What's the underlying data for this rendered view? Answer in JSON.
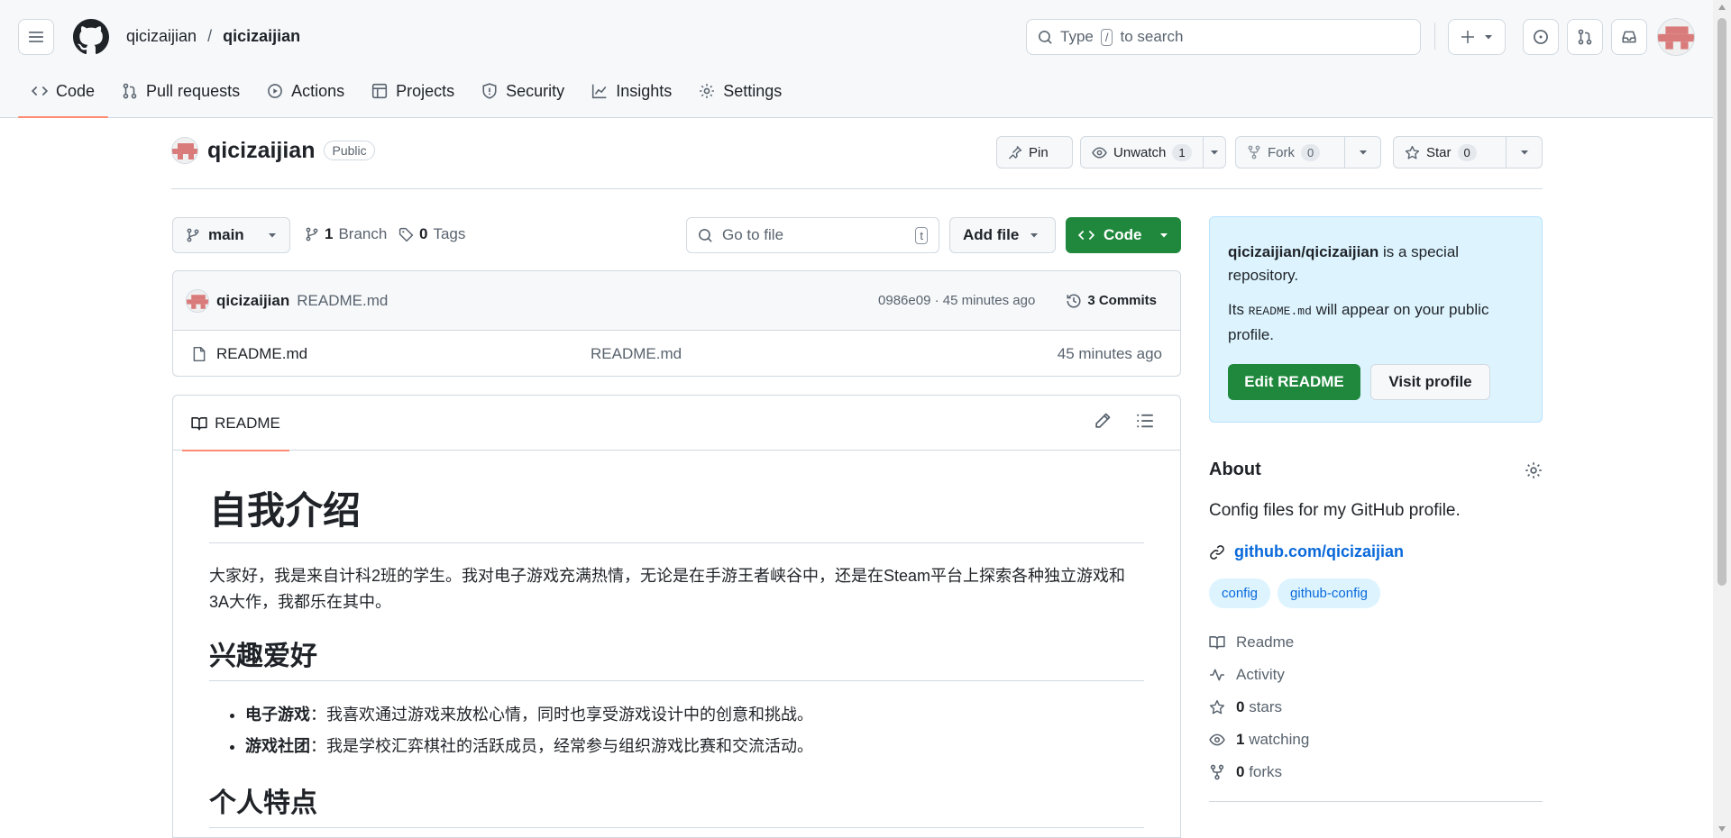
{
  "header": {
    "owner": "qicizaijian",
    "repo": "qicizaijian",
    "search_prefix": "Type",
    "search_key": "/",
    "search_suffix": "to search"
  },
  "nav_tabs": [
    {
      "label": "Code"
    },
    {
      "label": "Pull requests"
    },
    {
      "label": "Actions"
    },
    {
      "label": "Projects"
    },
    {
      "label": "Security"
    },
    {
      "label": "Insights"
    },
    {
      "label": "Settings"
    }
  ],
  "repo": {
    "name": "qicizaijian",
    "visibility": "Public",
    "pin_label": "Pin",
    "unwatch_label": "Unwatch",
    "watch_count": "1",
    "fork_label": "Fork",
    "fork_count": "0",
    "star_label": "Star",
    "star_count": "0"
  },
  "toolbar": {
    "branch": "main",
    "branch_count": "1",
    "branch_label": "Branch",
    "tag_count": "0",
    "tag_label": "Tags",
    "goto_placeholder": "Go to file",
    "goto_key": "t",
    "add_file": "Add file",
    "code": "Code"
  },
  "commit": {
    "author": "qicizaijian",
    "message": "README.md",
    "sha_time": "0986e09 · 45 minutes ago",
    "commits": "3 Commits"
  },
  "files": [
    {
      "name": "README.md",
      "message": "README.md",
      "time": "45 minutes ago"
    }
  ],
  "readme": {
    "tab": "README",
    "h1": "自我介绍",
    "p1": "大家好，我是来自计科2班的学生。我对电子游戏充满热情，无论是在手游王者峡谷中，还是在Steam平台上探索各种独立游戏和3A大作，我都乐在其中。",
    "h2a": "兴趣爱好",
    "items": [
      {
        "bold": "电子游戏",
        "text": "：我喜欢通过游戏来放松心情，同时也享受游戏设计中的创意和挑战。"
      },
      {
        "bold": "游戏社团",
        "text": "：我是学校汇弈棋社的活跃成员，经常参与组织游戏比赛和交流活动。"
      }
    ],
    "h2b": "个人特点"
  },
  "special": {
    "repo_full": "qicizaijian/qicizaijian",
    "line1_rest": " is a special repository.",
    "line2_pre": "Its ",
    "line2_code": "README.md",
    "line2_post": " will appear on your public profile.",
    "edit_btn": "Edit README",
    "visit_btn": "Visit profile"
  },
  "about": {
    "title": "About",
    "description": "Config files for my GitHub profile.",
    "link": "github.com/qicizaijian",
    "topics": [
      "config",
      "github-config"
    ],
    "readme": "Readme",
    "activity": "Activity",
    "stars_count": "0",
    "stars_label": "stars",
    "watching_count": "1",
    "watching_label": "watching",
    "forks_count": "0",
    "forks_label": "forks"
  },
  "colors": {
    "accent_green": "#1f883d",
    "link_blue": "#0969da",
    "tab_underline": "#fd8c73"
  }
}
